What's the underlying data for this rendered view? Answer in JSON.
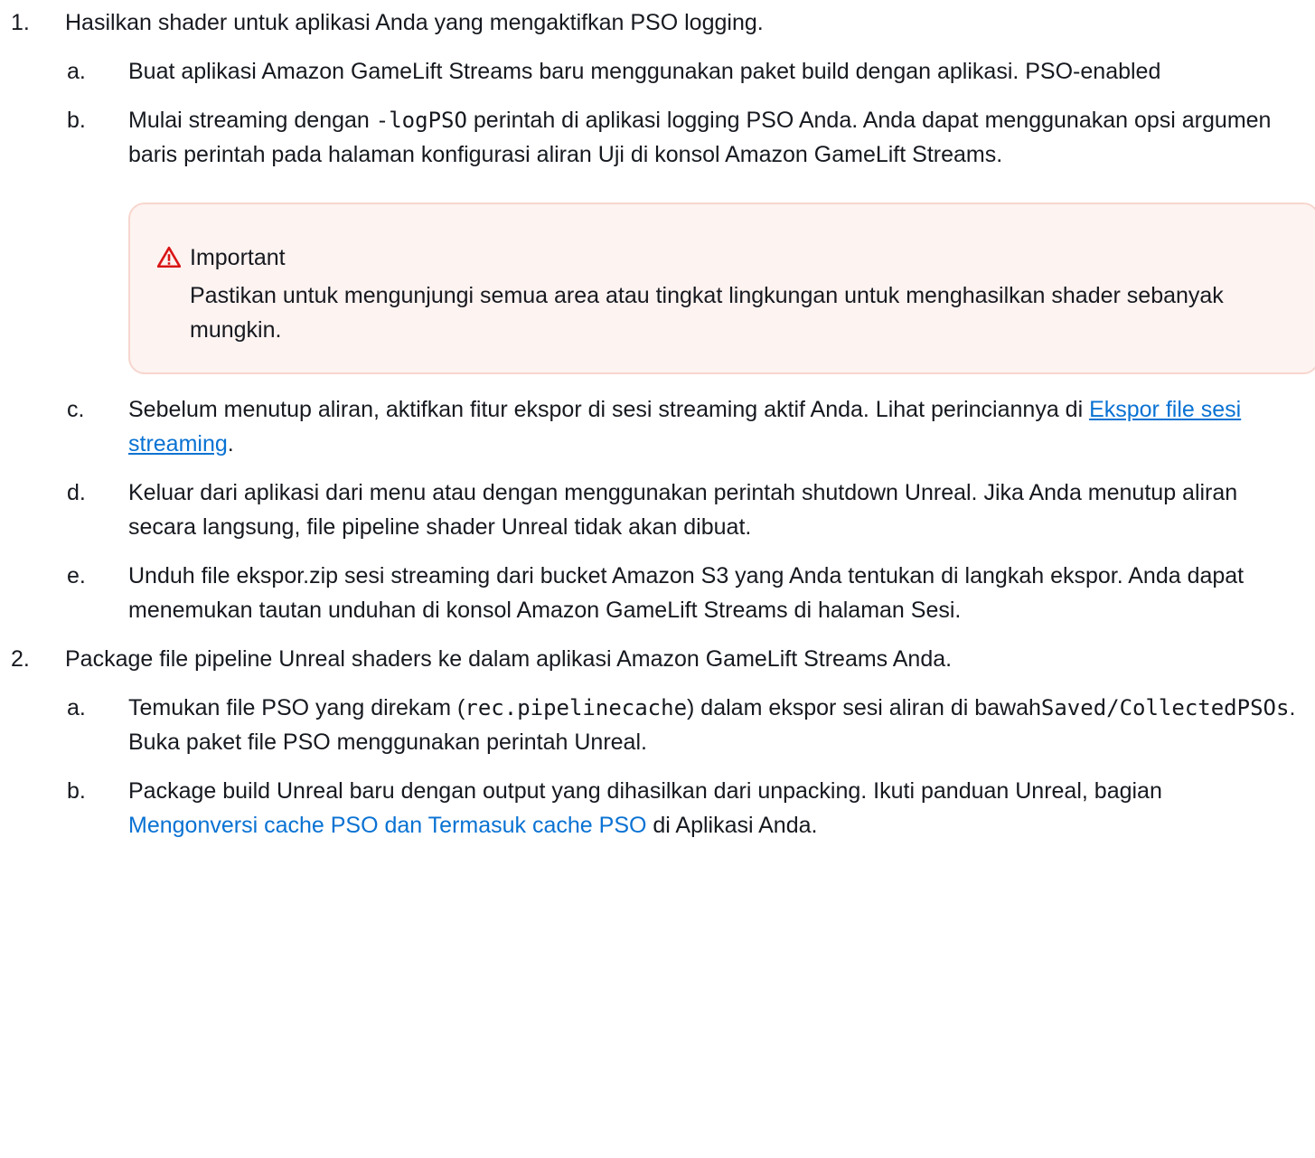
{
  "colors": {
    "link": "#0972d3",
    "alert_bg": "#fdf3f1",
    "alert_border": "#f7d6ce",
    "alert_icon": "#d91515"
  },
  "steps": [
    {
      "num": "1.",
      "text": "Hasilkan shader untuk aplikasi Anda yang mengaktifkan PSO logging.",
      "substeps": {
        "a": {
          "letter": "a.",
          "text": "Buat aplikasi Amazon GameLift Streams baru menggunakan paket build dengan aplikasi. PSO-enabled"
        },
        "b": {
          "letter": "b.",
          "pre": "Mulai streaming dengan ",
          "code": "-logPSO",
          "post": " perintah di aplikasi logging PSO Anda. Anda dapat menggunakan opsi argumen baris perintah pada halaman konfigurasi aliran Uji di konsol Amazon GameLift Streams."
        },
        "alert": {
          "icon": "warning-icon",
          "title": "Important",
          "body": "Pastikan untuk mengunjungi semua area atau tingkat lingkungan untuk menghasilkan shader sebanyak mungkin."
        },
        "c": {
          "letter": "c.",
          "pre": "Sebelum menutup aliran, aktifkan fitur ekspor di sesi streaming aktif Anda. Lihat perinciannya di ",
          "link": "Ekspor file sesi streaming",
          "post": "."
        },
        "d": {
          "letter": "d.",
          "text": "Keluar dari aplikasi dari menu atau dengan menggunakan perintah shutdown Unreal. Jika Anda menutup aliran secara langsung, file pipeline shader Unreal tidak akan dibuat."
        },
        "e": {
          "letter": "e.",
          "text": "Unduh file ekspor.zip sesi streaming dari bucket Amazon S3 yang Anda tentukan di langkah ekspor. Anda dapat menemukan tautan unduhan di konsol Amazon GameLift Streams di halaman Sesi."
        }
      }
    },
    {
      "num": "2.",
      "text": "Package file pipeline Unreal shaders ke dalam aplikasi Amazon GameLift Streams Anda.",
      "substeps": {
        "a": {
          "letter": "a.",
          "pre": "Temukan file PSO yang direkam (",
          "code1": "rec.pipelinecache",
          "mid": ") dalam ekspor sesi aliran di bawah",
          "code2": "Saved/CollectedPSOs",
          "post": ". Buka paket file PSO menggunakan perintah Unreal."
        },
        "b": {
          "letter": "b.",
          "pre": "Package build Unreal baru dengan output yang dihasilkan dari unpacking. Ikuti panduan Unreal, bagian ",
          "link": "Mengonversi cache PSO dan Termasuk cache PSO",
          "post": " di Aplikasi Anda."
        }
      }
    }
  ]
}
